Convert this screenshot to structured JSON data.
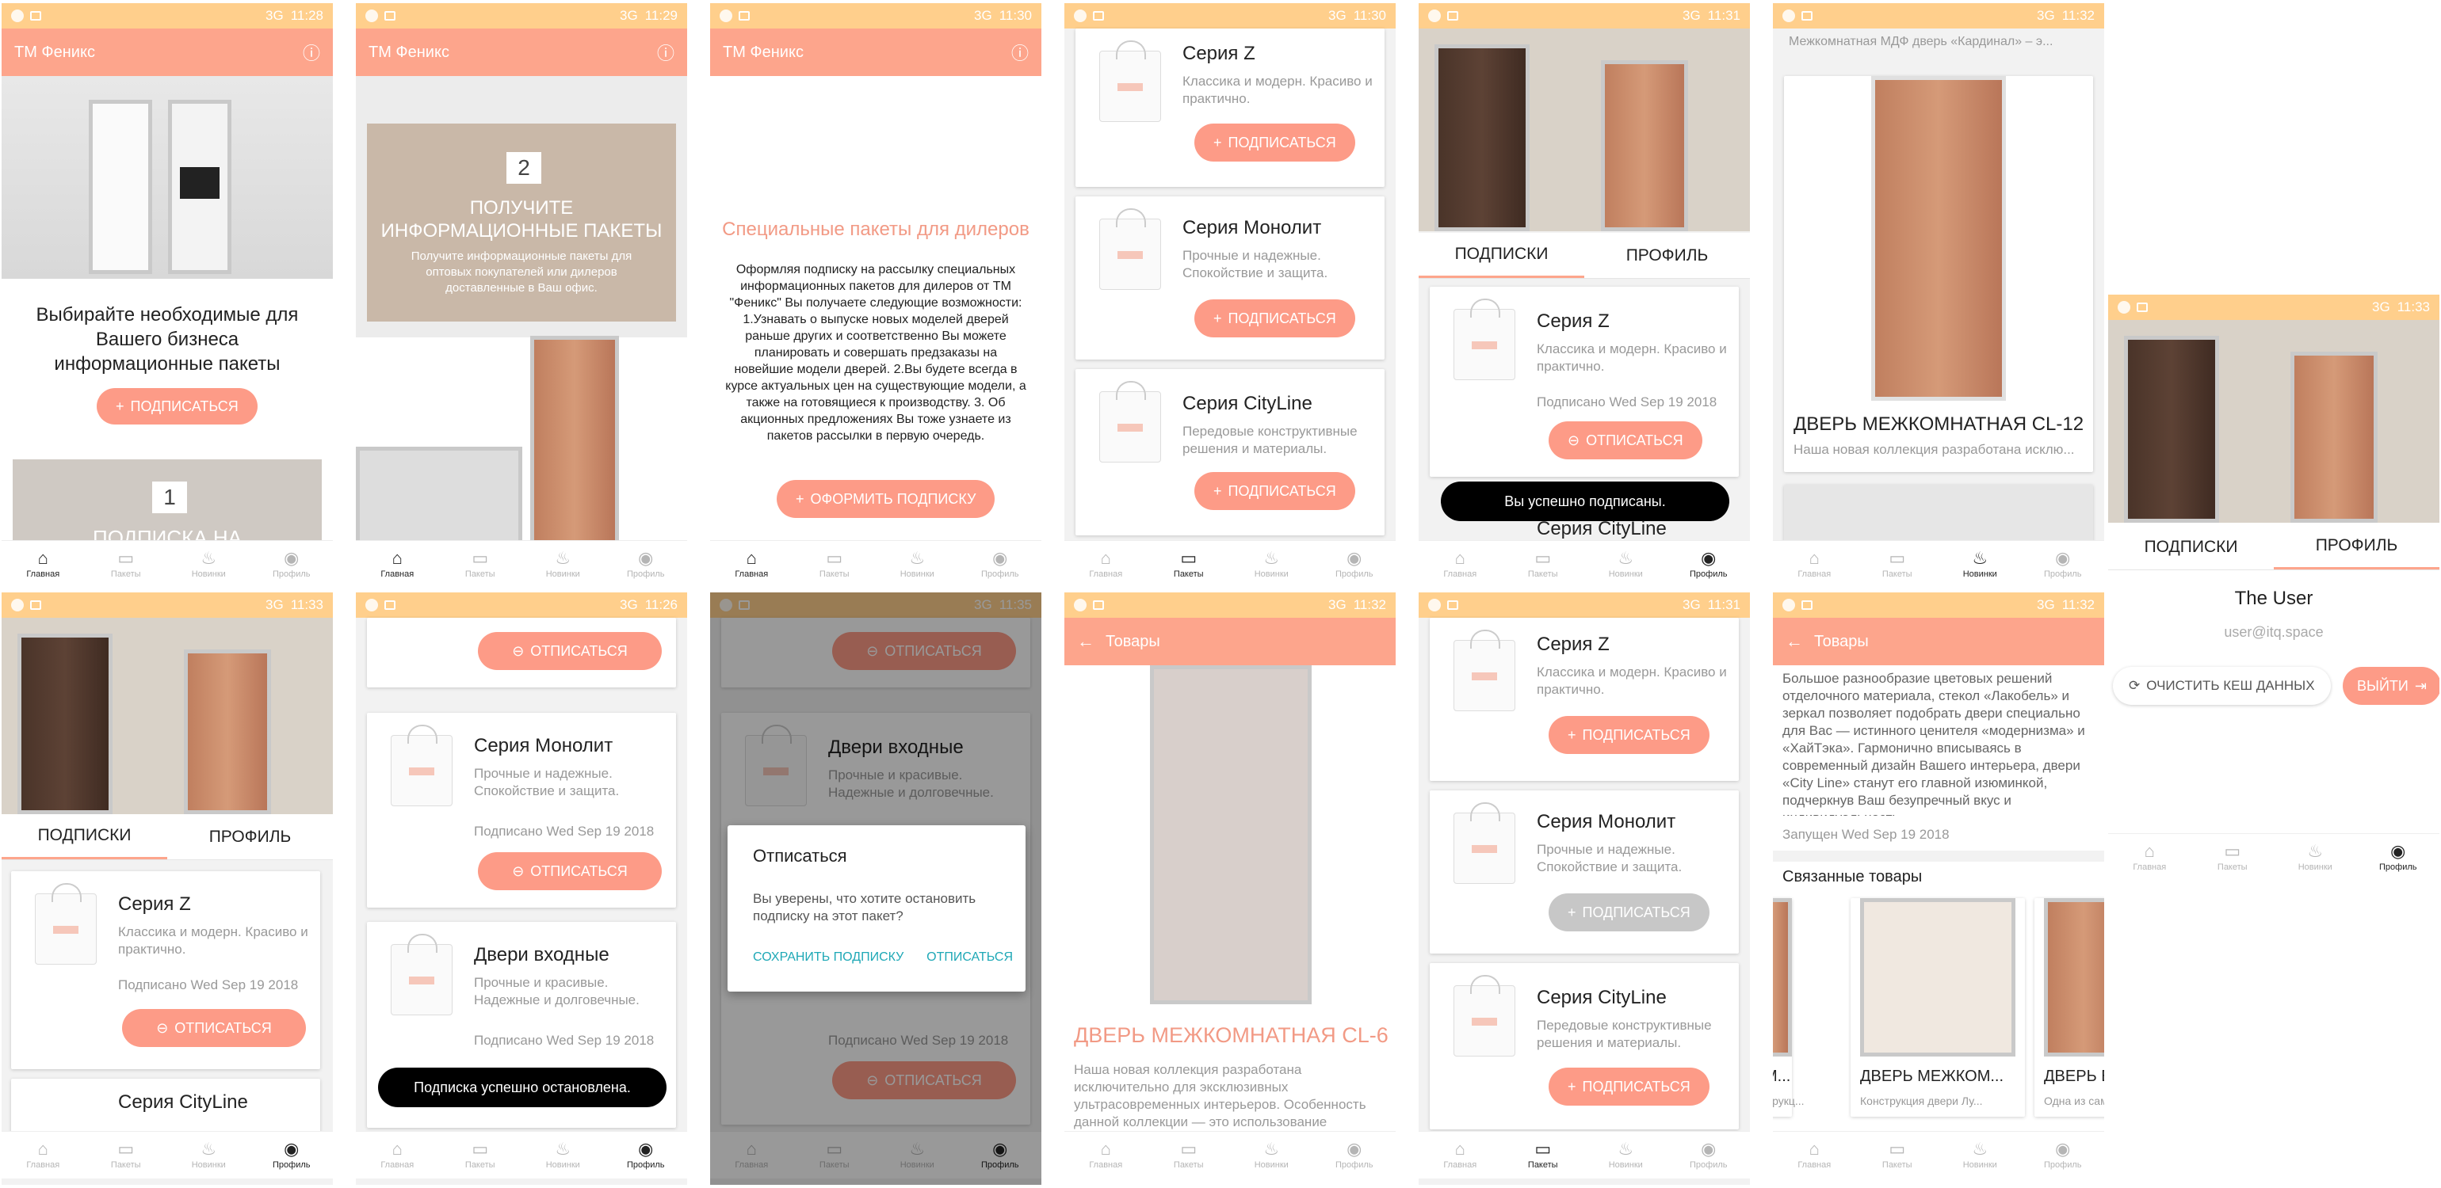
{
  "status": {
    "times": [
      "11:28",
      "11:29",
      "11:30",
      "11:30",
      "11:31",
      "11:32",
      "11:33",
      "11:33",
      "11:26",
      "11:35",
      "11:32",
      "11:31",
      "11:32"
    ],
    "net": "3G"
  },
  "app_title": "ТМ Феникс",
  "nav": {
    "home": "Главная",
    "packets": "Пакеты",
    "news": "Новинки",
    "profile": "Профиль"
  },
  "s1": {
    "headline": "Выбирайте необходимые для Вашего бизнеса информационные пакеты",
    "subscribe": "ПОДПИСАТЬСЯ",
    "step_num": "1",
    "step_title": "ПОДПИСКА НА"
  },
  "s2": {
    "step_num": "2",
    "step_title": "ПОЛУЧИТЕ ИНФОРМАЦИОННЫЕ ПАКЕТЫ",
    "step_text": "Получите информационные пакеты для оптовых покупателей или дилеров доставленные в Ваш офис."
  },
  "s3": {
    "title": "Специальные пакеты для дилеров",
    "body": "Оформляя подписку на рассылку специальных информационных пакетов для дилеров от ТМ \"Феникс\" Вы получаете следующие возможности: 1.Узнавать о выпуске новых моделей дверей раньше других и соответственно Вы можете планировать и совершать предзаказы на новейшие модели дверей. 2.Вы будете всегда в курсе актуальных цен на существующие модели, а также на готовящиеся к производству. 3. Об акционных предложениях Вы тоже узнаете из пакетов рассылки в первую очередь.",
    "button": "ОФОРМИТЬ ПОДПИСКУ"
  },
  "series": {
    "z": {
      "title": "Серия Z",
      "desc": "Классика и модерн. Красиво и практично."
    },
    "mono": {
      "title": "Серия Монолит",
      "desc": "Прочные и надежные. Спокойствие и защита."
    },
    "city": {
      "title": "Серия CityLine",
      "desc": "Передовые конструктивные решения и материалы."
    },
    "entry": {
      "title": "Двери входные",
      "desc": "Прочные и красивые. Надежные и долговечные."
    }
  },
  "buttons": {
    "subscribe": "ПОДПИСАТЬСЯ",
    "unsubscribe": "ОТПИСАТЬСЯ"
  },
  "subscribed_on": "Подписано Wed Sep 19 2018",
  "tabs": {
    "subs": "ПОДПИСКИ",
    "profile": "ПРОФИЛЬ"
  },
  "toast": {
    "subscribed": "Вы успешно подписаны.",
    "stopped": "Подписка успешно остановлена."
  },
  "s6": {
    "top": "Межкомнатная МДФ дверь «Кардинал» – э...",
    "door": "ДВЕРЬ МЕЖКОМНАТНАЯ CL-12",
    "door_desc": "Наша новая коллекция разработана исклю..."
  },
  "profile": {
    "name": "The User",
    "email": "user@itq.space",
    "clear": "ОЧИСТИТЬ КЕШ ДАННЫХ",
    "logout": "ВЫЙТИ"
  },
  "dialog": {
    "title": "Отписаться",
    "text": "Вы уверены, что хотите остановить подписку на этот пакет?",
    "keep": "СОХРАНИТЬ ПОДПИСКУ",
    "unsub": "ОТПИСАТЬСЯ"
  },
  "goods": "Товары",
  "s10": {
    "door": "ДВЕРЬ МЕЖКОМНАТНАЯ CL-6",
    "desc": "Наша новая коллекция разработана исключительно для эксклюзивных ультрасовременных интерьеров. Особенность данной коллекции — это использование"
  },
  "s12": {
    "desc": "Большое разнообразие цветовых решений отделочного материала, стекол «Лакобель» и зеркал позволяет подобрать двери специально для Вас — истинного ценителя «модернизма» и «ХайТэка». Гармонично вписываясь в современный дизайн Вашего интерьера, двери «City Line» станут его главной изюминкой, подчеркнув Ваш безупречный вкус и индивидуальность.",
    "started": "Запущен Wed Sep 19 2018",
    "related": "Связанные товары",
    "r1": "КОМ...",
    "r1d": "Конструкц...",
    "r2": "ДВЕРЬ МЕЖКОМ...",
    "r2d": "Конструкция двери Лу...",
    "r3": "ДВЕРЬ ВХ...",
    "r3d": "Одна из сам..."
  }
}
